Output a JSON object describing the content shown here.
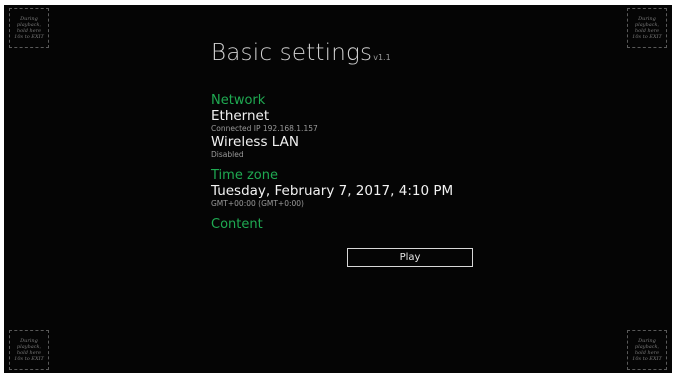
{
  "corners": {
    "hint": "During playback, hold here 10s to EXIT"
  },
  "header": {
    "title": "Basic settings",
    "version": "v1.1"
  },
  "network": {
    "heading": "Network",
    "ethernet": {
      "title": "Ethernet",
      "status": "Connected IP 192.168.1.157"
    },
    "wireless": {
      "title": "Wireless LAN",
      "status": "Disabled"
    }
  },
  "timezone": {
    "heading": "Time zone",
    "datetime": "Tuesday, February 7, 2017, 4:10 PM",
    "offset": "GMT+00:00 (GMT+0:00)"
  },
  "content": {
    "heading": "Content",
    "play_label": "Play"
  },
  "colors": {
    "background": "#050505",
    "heading_accent": "#1faa52",
    "primary_text": "#f2f2f2",
    "secondary_text": "#9a9a9a"
  }
}
